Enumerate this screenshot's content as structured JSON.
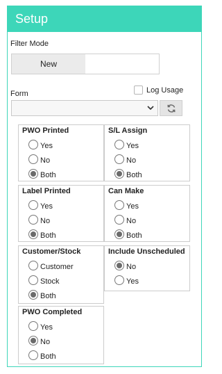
{
  "header": {
    "title": "Setup"
  },
  "filter": {
    "label": "Filter Mode",
    "option": "New"
  },
  "log": {
    "label": "Log Usage"
  },
  "form": {
    "label": "Form",
    "value": ""
  },
  "groups": {
    "pwo_printed": {
      "title": "PWO Printed",
      "options": [
        "Yes",
        "No",
        "Both"
      ],
      "selected": "Both"
    },
    "sl_assign": {
      "title": "S/L Assign",
      "options": [
        "Yes",
        "No",
        "Both"
      ],
      "selected": "Both"
    },
    "label_printed": {
      "title": "Label Printed",
      "options": [
        "Yes",
        "No",
        "Both"
      ],
      "selected": "Both"
    },
    "can_make": {
      "title": "Can Make",
      "options": [
        "Yes",
        "No",
        "Both"
      ],
      "selected": "Both"
    },
    "customer_stock": {
      "title": "Customer/Stock",
      "options": [
        "Customer",
        "Stock",
        "Both"
      ],
      "selected": "Both"
    },
    "include_unscheduled": {
      "title": "Include Unscheduled",
      "options": [
        "No",
        "Yes"
      ],
      "selected": "No"
    },
    "pwo_completed": {
      "title": "PWO Completed",
      "options": [
        "Yes",
        "No",
        "Both"
      ],
      "selected": "No"
    }
  },
  "colors": {
    "accent": "#3dd6b9"
  }
}
